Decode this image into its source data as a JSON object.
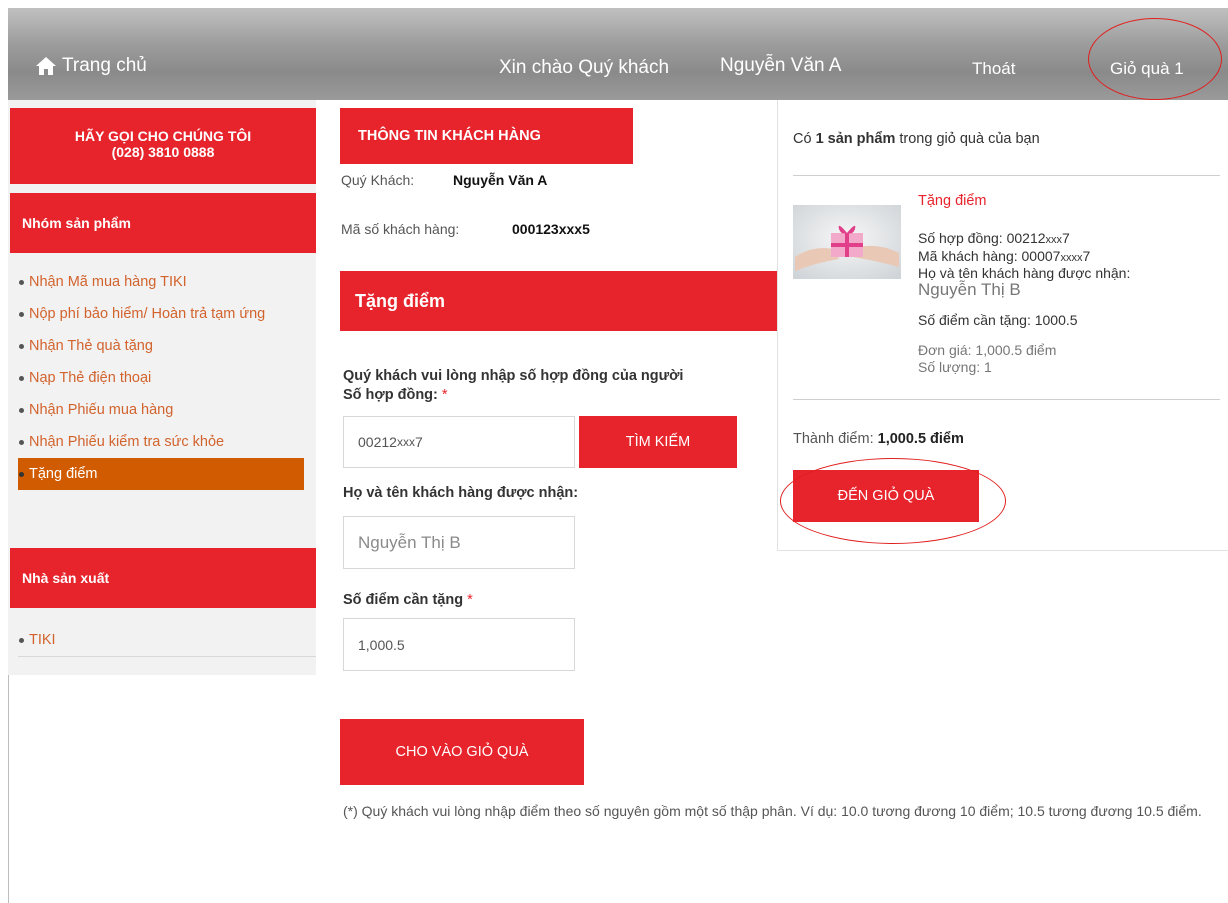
{
  "header": {
    "home_label": "Trang chủ",
    "greeting": "Xin chào Quý khách",
    "user_name": "Nguyễn Văn A",
    "logout_label": "Thoát",
    "cart_label": "Giỏ quà 1"
  },
  "sidebar": {
    "call_line1": "HÃY GỌI CHO CHÚNG TÔI",
    "call_line2": "(028) 3810 0888",
    "product_group_title": "Nhóm sản phẩm",
    "product_items": [
      {
        "label": "Nhận Mã mua hàng TIKI"
      },
      {
        "label": "Nộp phí bảo hiểm/ Hoàn trả tạm ứng"
      },
      {
        "label": "Nhận Thẻ quà tặng"
      },
      {
        "label": "Nạp Thẻ điện thoại"
      },
      {
        "label": "Nhận Phiếu mua hàng"
      },
      {
        "label": "Nhận Phiếu kiểm tra sức khỏe"
      },
      {
        "label": "Tặng điểm"
      }
    ],
    "manufacturer_title": "Nhà sản xuất",
    "manufacturer_items": [
      {
        "label": "TIKI"
      }
    ]
  },
  "customer": {
    "section_title": "THÔNG TIN KHÁCH HÀNG",
    "name_label": "Quý Khách:",
    "name_value": "Nguyễn Văn A",
    "id_label": "Mã số khách hàng:",
    "id_value": "000123xxx5"
  },
  "gift_form": {
    "title": "Tặng điểm",
    "instruction": "Quý khách vui lòng nhập số hợp đồng của người",
    "contract_label": "Số hợp đồng:",
    "required_mark": "*",
    "contract_value_prefix": "00212",
    "contract_value_mask": "xxx",
    "contract_value_suffix": "7",
    "search_button": "TÌM KIẾM",
    "recipient_label": "Họ và tên khách hàng được nhận:",
    "recipient_value": "Nguyễn Thị B",
    "points_label": "Số điểm cần tặng",
    "points_value": "1,000.5",
    "add_button": "CHO VÀO GIỎ QUÀ",
    "note": "(*) Quý khách vui lòng nhập điểm theo số nguyên gồm một số thập phân. Ví dụ: 10.0 tương đương 10 điểm; 10.5 tương đương 10.5 điểm."
  },
  "cart": {
    "count_prefix": "Có",
    "count_bold": "1 sản phẩm",
    "count_suffix": "trong giỏ quà của bạn",
    "item_title": "Tặng điểm",
    "contract_line_prefix": "Số hợp đồng: 00212",
    "contract_line_mask": "xxx",
    "contract_line_suffix": "7",
    "customer_line_prefix": "Mã khách hàng: 00007",
    "customer_line_mask": "xxxx",
    "customer_line_suffix": "7",
    "recipient_label": "Họ và tên khách hàng được nhận:",
    "recipient_name": "Nguyễn Thị B",
    "points_line": "Số điểm cần tặng: 1000.5",
    "unit_price": "Đơn giá: 1,000.5 điểm",
    "quantity": "Số lượng: 1",
    "total_label": "Thành điểm:",
    "total_value": "1,000.5 điểm",
    "go_button": "ĐẾN GIỎ QUÀ"
  },
  "colors": {
    "brand_red": "#e7232b",
    "link_orange": "#d2632d",
    "active_orange": "#d15b00",
    "annotation_red": "#e0201e"
  },
  "icons": {
    "home": "home-icon",
    "gift_thumbnail": "gift-image"
  }
}
